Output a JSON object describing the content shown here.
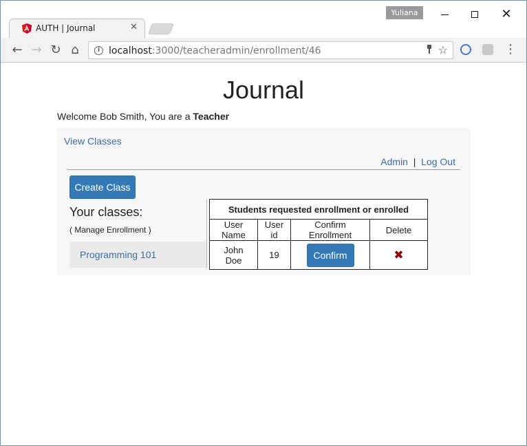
{
  "browser": {
    "profile_name": "Yuliana",
    "tab_title": "AUTH | Journal",
    "tab_close": "✕",
    "url_host": "localhost",
    "url_path": ":3000/teacheradmin/enrollment/46"
  },
  "page": {
    "title": "Journal",
    "welcome_prefix": "Welcome Bob Smith, You are a ",
    "role": "Teacher",
    "view_classes": "View Classes",
    "admin_link": "Admin",
    "separator": "|",
    "logout_link": "Log Out",
    "create_class": "Create Class",
    "your_classes": "Your classes:",
    "manage_enrollment": "( Manage Enrollment )",
    "classes": [
      "Programming 101"
    ]
  },
  "enrollment_table": {
    "caption": "Students requested enrollment or enrolled",
    "headers": [
      "User Name",
      "User id",
      "Confirm Enrollment",
      "Delete"
    ],
    "rows": [
      {
        "user_name": "John Doe",
        "user_id": "19",
        "confirm_label": "Confirm",
        "delete_icon": "✖"
      }
    ]
  },
  "colors": {
    "primary_button": "#337ab7",
    "link": "#3a6fa6",
    "delete": "#8b0000"
  }
}
